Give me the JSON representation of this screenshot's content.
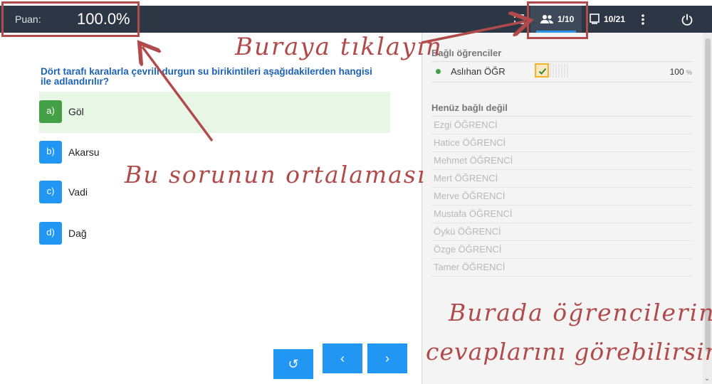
{
  "topbar": {
    "score_label": "Puan:",
    "score_value": "100.0%",
    "students_count": "1/10",
    "questions_count": "10/21",
    "icons": [
      "fullscreen-icon",
      "students-icon",
      "questions-icon",
      "more-vert-icon",
      "power-icon"
    ]
  },
  "question": {
    "text": "Dört tarafı karalarla çevrili durgun su birikintileri aşağıdakilerden hangisi ile adlandırılır?",
    "options": [
      {
        "letter": "a)",
        "text": "Göl",
        "selected": true
      },
      {
        "letter": "b)",
        "text": "Akarsu",
        "selected": false
      },
      {
        "letter": "c)",
        "text": "Vadi",
        "selected": false
      },
      {
        "letter": "d)",
        "text": "Dağ",
        "selected": false
      }
    ]
  },
  "navigation": {
    "reset_icon": "↺",
    "prev_icon": "‹",
    "next_icon": "›"
  },
  "panel": {
    "connected_title": "Bağlı öğrenciler",
    "connected_students": [
      {
        "name": "Aslıhan ÖĞR",
        "score": "100",
        "unit": "%",
        "status": "online",
        "answer": "correct"
      }
    ],
    "pending_title": "Henüz bağlı değil",
    "pending_students": [
      "Ezgi ÖĞRENCİ",
      "Hatice ÖĞRENCİ",
      "Mehmet ÖĞRENCİ",
      "Mert ÖĞRENCİ",
      "Merve ÖĞRENCİ",
      "Mustafa ÖĞRENCİ",
      "Öykü ÖĞRENCİ",
      "Özge ÖĞRENCİ",
      "Tamer ÖĞRENCİ"
    ]
  },
  "annotations": {
    "click_here": "Buraya tıklayın",
    "question_average": "Bu sorunun ortalaması",
    "answers_line1": "Burada öğrencilerin",
    "answers_line2": "cevaplarını görebilirsiniz",
    "color": "#b14b4b"
  },
  "colors": {
    "topbar": "#2c3645",
    "accent_blue": "#2196f3",
    "correct_green": "#43a047",
    "question_text": "#1c63b5",
    "check_highlight": "#f0b429"
  }
}
